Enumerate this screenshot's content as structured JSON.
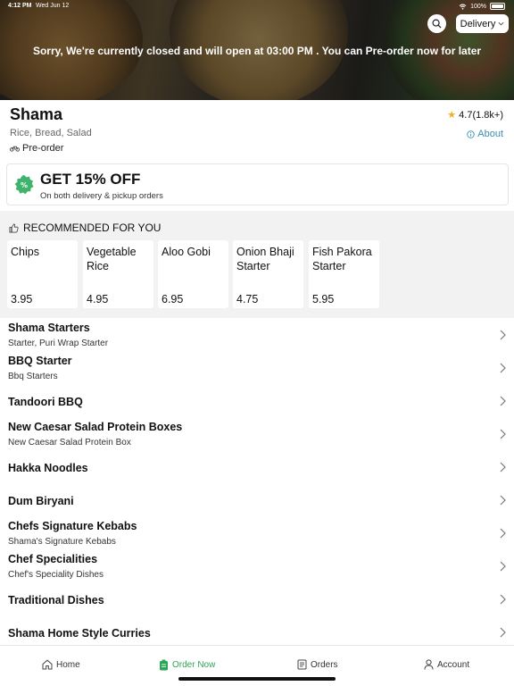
{
  "status_bar": {
    "time": "4:12 PM",
    "date": "Wed Jun 12",
    "battery": "100%"
  },
  "header": {
    "closed_message": "Sorry, We're currently closed and will open at 03:00 PM . You can Pre-order now for later",
    "search_icon": "search-icon",
    "delivery_mode": "Delivery"
  },
  "restaurant": {
    "name": "Shama",
    "categories": "Rice, Bread, Salad",
    "preorder_label": "Pre-order",
    "rating": "4.7(1.8k+)",
    "about_label": "About"
  },
  "offer": {
    "title": "GET 15% OFF",
    "subtitle": "On both delivery & pickup orders",
    "accent": "#3fb36b"
  },
  "recommended": {
    "heading": "RECOMMENDED FOR YOU",
    "items": [
      {
        "name": "Chips",
        "price": "3.95"
      },
      {
        "name": "Vegetable Rice",
        "price": "4.95"
      },
      {
        "name": "Aloo Gobi",
        "price": "6.95"
      },
      {
        "name": "Onion Bhaji Starter",
        "price": "4.75"
      },
      {
        "name": "Fish Pakora Starter",
        "price": "5.95"
      }
    ]
  },
  "menu_categories": [
    {
      "title": "Shama Starters",
      "subtitle": "Starter, Puri Wrap Starter"
    },
    {
      "title": "BBQ Starter",
      "subtitle": "Bbq Starters"
    },
    {
      "title": "Tandoori BBQ",
      "subtitle": ""
    },
    {
      "title": "New Caesar Salad Protein Boxes",
      "subtitle": "New Caesar Salad Protein Box"
    },
    {
      "title": "Hakka Noodles",
      "subtitle": ""
    },
    {
      "title": "Dum Biryani",
      "subtitle": ""
    },
    {
      "title": "Chefs Signature Kebabs",
      "subtitle": "Shama's Signature Kebabs"
    },
    {
      "title": "Chef Specialities",
      "subtitle": "Chef's Speciality Dishes"
    },
    {
      "title": "Traditional Dishes",
      "subtitle": ""
    },
    {
      "title": "Shama Home Style Curries",
      "subtitle": ""
    }
  ],
  "bottom_nav": {
    "home": "Home",
    "order_now": "Order Now",
    "orders": "Orders",
    "account": "Account",
    "active_color": "#2ea657"
  }
}
